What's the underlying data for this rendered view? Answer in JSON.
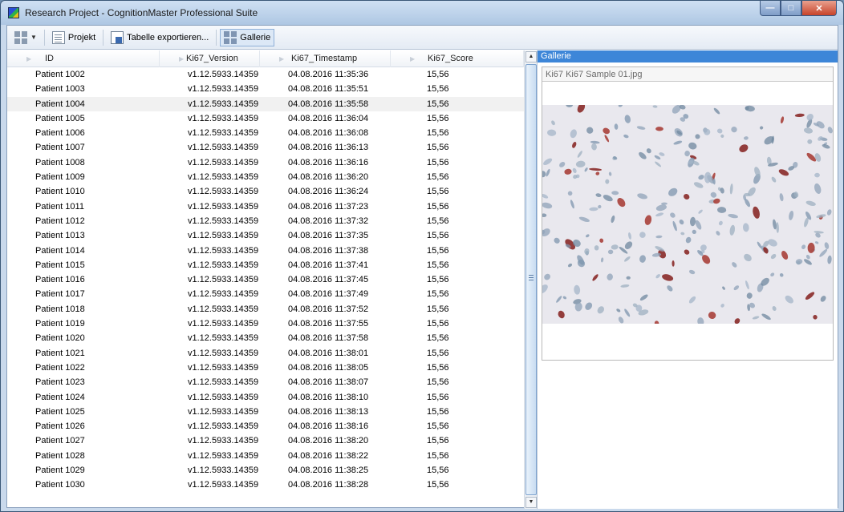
{
  "window": {
    "title": "Research Project - CognitionMaster Professional Suite"
  },
  "toolbar": {
    "projekt_label": "Projekt",
    "export_label": "Tabelle exportieren...",
    "gallery_label": "Gallerie"
  },
  "table": {
    "columns": [
      "ID",
      "Ki67_Version",
      "Ki67_Timestamp",
      "Ki67_Score"
    ],
    "rows": [
      [
        "Patient 1002",
        "v1.12.5933.14359",
        "04.08.2016 11:35:36",
        "15,56"
      ],
      [
        "Patient 1003",
        "v1.12.5933.14359",
        "04.08.2016 11:35:51",
        "15,56"
      ],
      [
        "Patient 1004",
        "v1.12.5933.14359",
        "04.08.2016 11:35:58",
        "15,56"
      ],
      [
        "Patient 1005",
        "v1.12.5933.14359",
        "04.08.2016 11:36:04",
        "15,56"
      ],
      [
        "Patient 1006",
        "v1.12.5933.14359",
        "04.08.2016 11:36:08",
        "15,56"
      ],
      [
        "Patient 1007",
        "v1.12.5933.14359",
        "04.08.2016 11:36:13",
        "15,56"
      ],
      [
        "Patient 1008",
        "v1.12.5933.14359",
        "04.08.2016 11:36:16",
        "15,56"
      ],
      [
        "Patient 1009",
        "v1.12.5933.14359",
        "04.08.2016 11:36:20",
        "15,56"
      ],
      [
        "Patient 1010",
        "v1.12.5933.14359",
        "04.08.2016 11:36:24",
        "15,56"
      ],
      [
        "Patient 1011",
        "v1.12.5933.14359",
        "04.08.2016 11:37:23",
        "15,56"
      ],
      [
        "Patient 1012",
        "v1.12.5933.14359",
        "04.08.2016 11:37:32",
        "15,56"
      ],
      [
        "Patient 1013",
        "v1.12.5933.14359",
        "04.08.2016 11:37:35",
        "15,56"
      ],
      [
        "Patient 1014",
        "v1.12.5933.14359",
        "04.08.2016 11:37:38",
        "15,56"
      ],
      [
        "Patient 1015",
        "v1.12.5933.14359",
        "04.08.2016 11:37:41",
        "15,56"
      ],
      [
        "Patient 1016",
        "v1.12.5933.14359",
        "04.08.2016 11:37:45",
        "15,56"
      ],
      [
        "Patient 1017",
        "v1.12.5933.14359",
        "04.08.2016 11:37:49",
        "15,56"
      ],
      [
        "Patient 1018",
        "v1.12.5933.14359",
        "04.08.2016 11:37:52",
        "15,56"
      ],
      [
        "Patient 1019",
        "v1.12.5933.14359",
        "04.08.2016 11:37:55",
        "15,56"
      ],
      [
        "Patient 1020",
        "v1.12.5933.14359",
        "04.08.2016 11:37:58",
        "15,56"
      ],
      [
        "Patient 1021",
        "v1.12.5933.14359",
        "04.08.2016 11:38:01",
        "15,56"
      ],
      [
        "Patient 1022",
        "v1.12.5933.14359",
        "04.08.2016 11:38:05",
        "15,56"
      ],
      [
        "Patient 1023",
        "v1.12.5933.14359",
        "04.08.2016 11:38:07",
        "15,56"
      ],
      [
        "Patient 1024",
        "v1.12.5933.14359",
        "04.08.2016 11:38:10",
        "15,56"
      ],
      [
        "Patient 1025",
        "v1.12.5933.14359",
        "04.08.2016 11:38:13",
        "15,56"
      ],
      [
        "Patient 1026",
        "v1.12.5933.14359",
        "04.08.2016 11:38:16",
        "15,56"
      ],
      [
        "Patient 1027",
        "v1.12.5933.14359",
        "04.08.2016 11:38:20",
        "15,56"
      ],
      [
        "Patient 1028",
        "v1.12.5933.14359",
        "04.08.2016 11:38:22",
        "15,56"
      ],
      [
        "Patient 1029",
        "v1.12.5933.14359",
        "04.08.2016 11:38:25",
        "15,56"
      ],
      [
        "Patient 1030",
        "v1.12.5933.14359",
        "04.08.2016 11:38:28",
        "15,56"
      ]
    ]
  },
  "gallery": {
    "header": "Gallerie",
    "caption": "Ki67 Ki67 Sample 01.jpg"
  },
  "icons": {
    "app": "app-icon",
    "grid": "grid-icon",
    "projekt": "document-icon",
    "export": "export-icon",
    "gallery": "gallery-icon"
  }
}
